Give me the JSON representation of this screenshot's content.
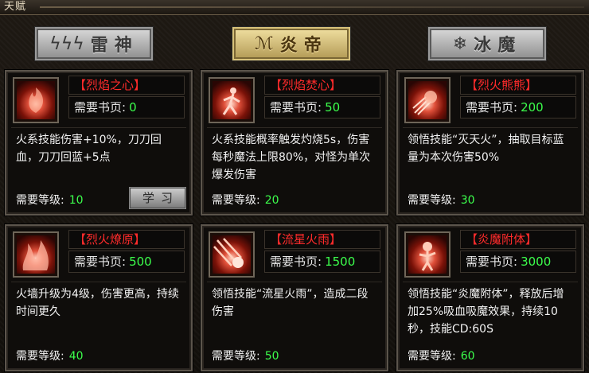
{
  "window": {
    "title": "天赋"
  },
  "tabs": [
    {
      "label": "雷神",
      "icon": "lightning-icon",
      "active": false
    },
    {
      "label": "炎帝",
      "icon": "flame-icon",
      "active": true
    },
    {
      "label": "冰魔",
      "icon": "snowflake-icon",
      "active": false
    }
  ],
  "labels": {
    "pages": "需要书页:",
    "level": "需要等级:",
    "learn": "学习"
  },
  "skills": [
    {
      "name": "【烈焰之心】",
      "pages": "0",
      "desc": "火系技能伤害+10%，刀刀回血，刀刀回蓝+5点",
      "level": "10",
      "icon": "flame-heart-icon"
    },
    {
      "name": "【烈焰焚心】",
      "pages": "50",
      "desc": "火系技能概率触发灼烧5s，伤害每秒魔法上限80%，对怪为单次爆发伤害",
      "level": "20",
      "icon": "burning-figure-icon"
    },
    {
      "name": "【烈火熊熊】",
      "pages": "200",
      "desc": "领悟技能“灭天火”，抽取目标蓝量为本次伤害50%",
      "level": "30",
      "icon": "fire-burst-icon"
    },
    {
      "name": "【烈火燎原】",
      "pages": "500",
      "desc": "火墙升级为4级，伤害更高，持续时间更久",
      "level": "40",
      "icon": "firewall-icon"
    },
    {
      "name": "【流星火雨】",
      "pages": "1500",
      "desc": "领悟技能“流星火雨”，造成二段伤害",
      "level": "50",
      "icon": "meteor-icon"
    },
    {
      "name": "【炎魔附体】",
      "pages": "3000",
      "desc": "领悟技能“炎魔附体”，释放后增加25%吸血吸魔效果，持续10秒，技能CD:60S",
      "level": "60",
      "icon": "fire-demon-icon"
    }
  ],
  "colors": {
    "name": "#ff2b2b",
    "value": "#3cff4c",
    "text": "#f2f2f2"
  }
}
